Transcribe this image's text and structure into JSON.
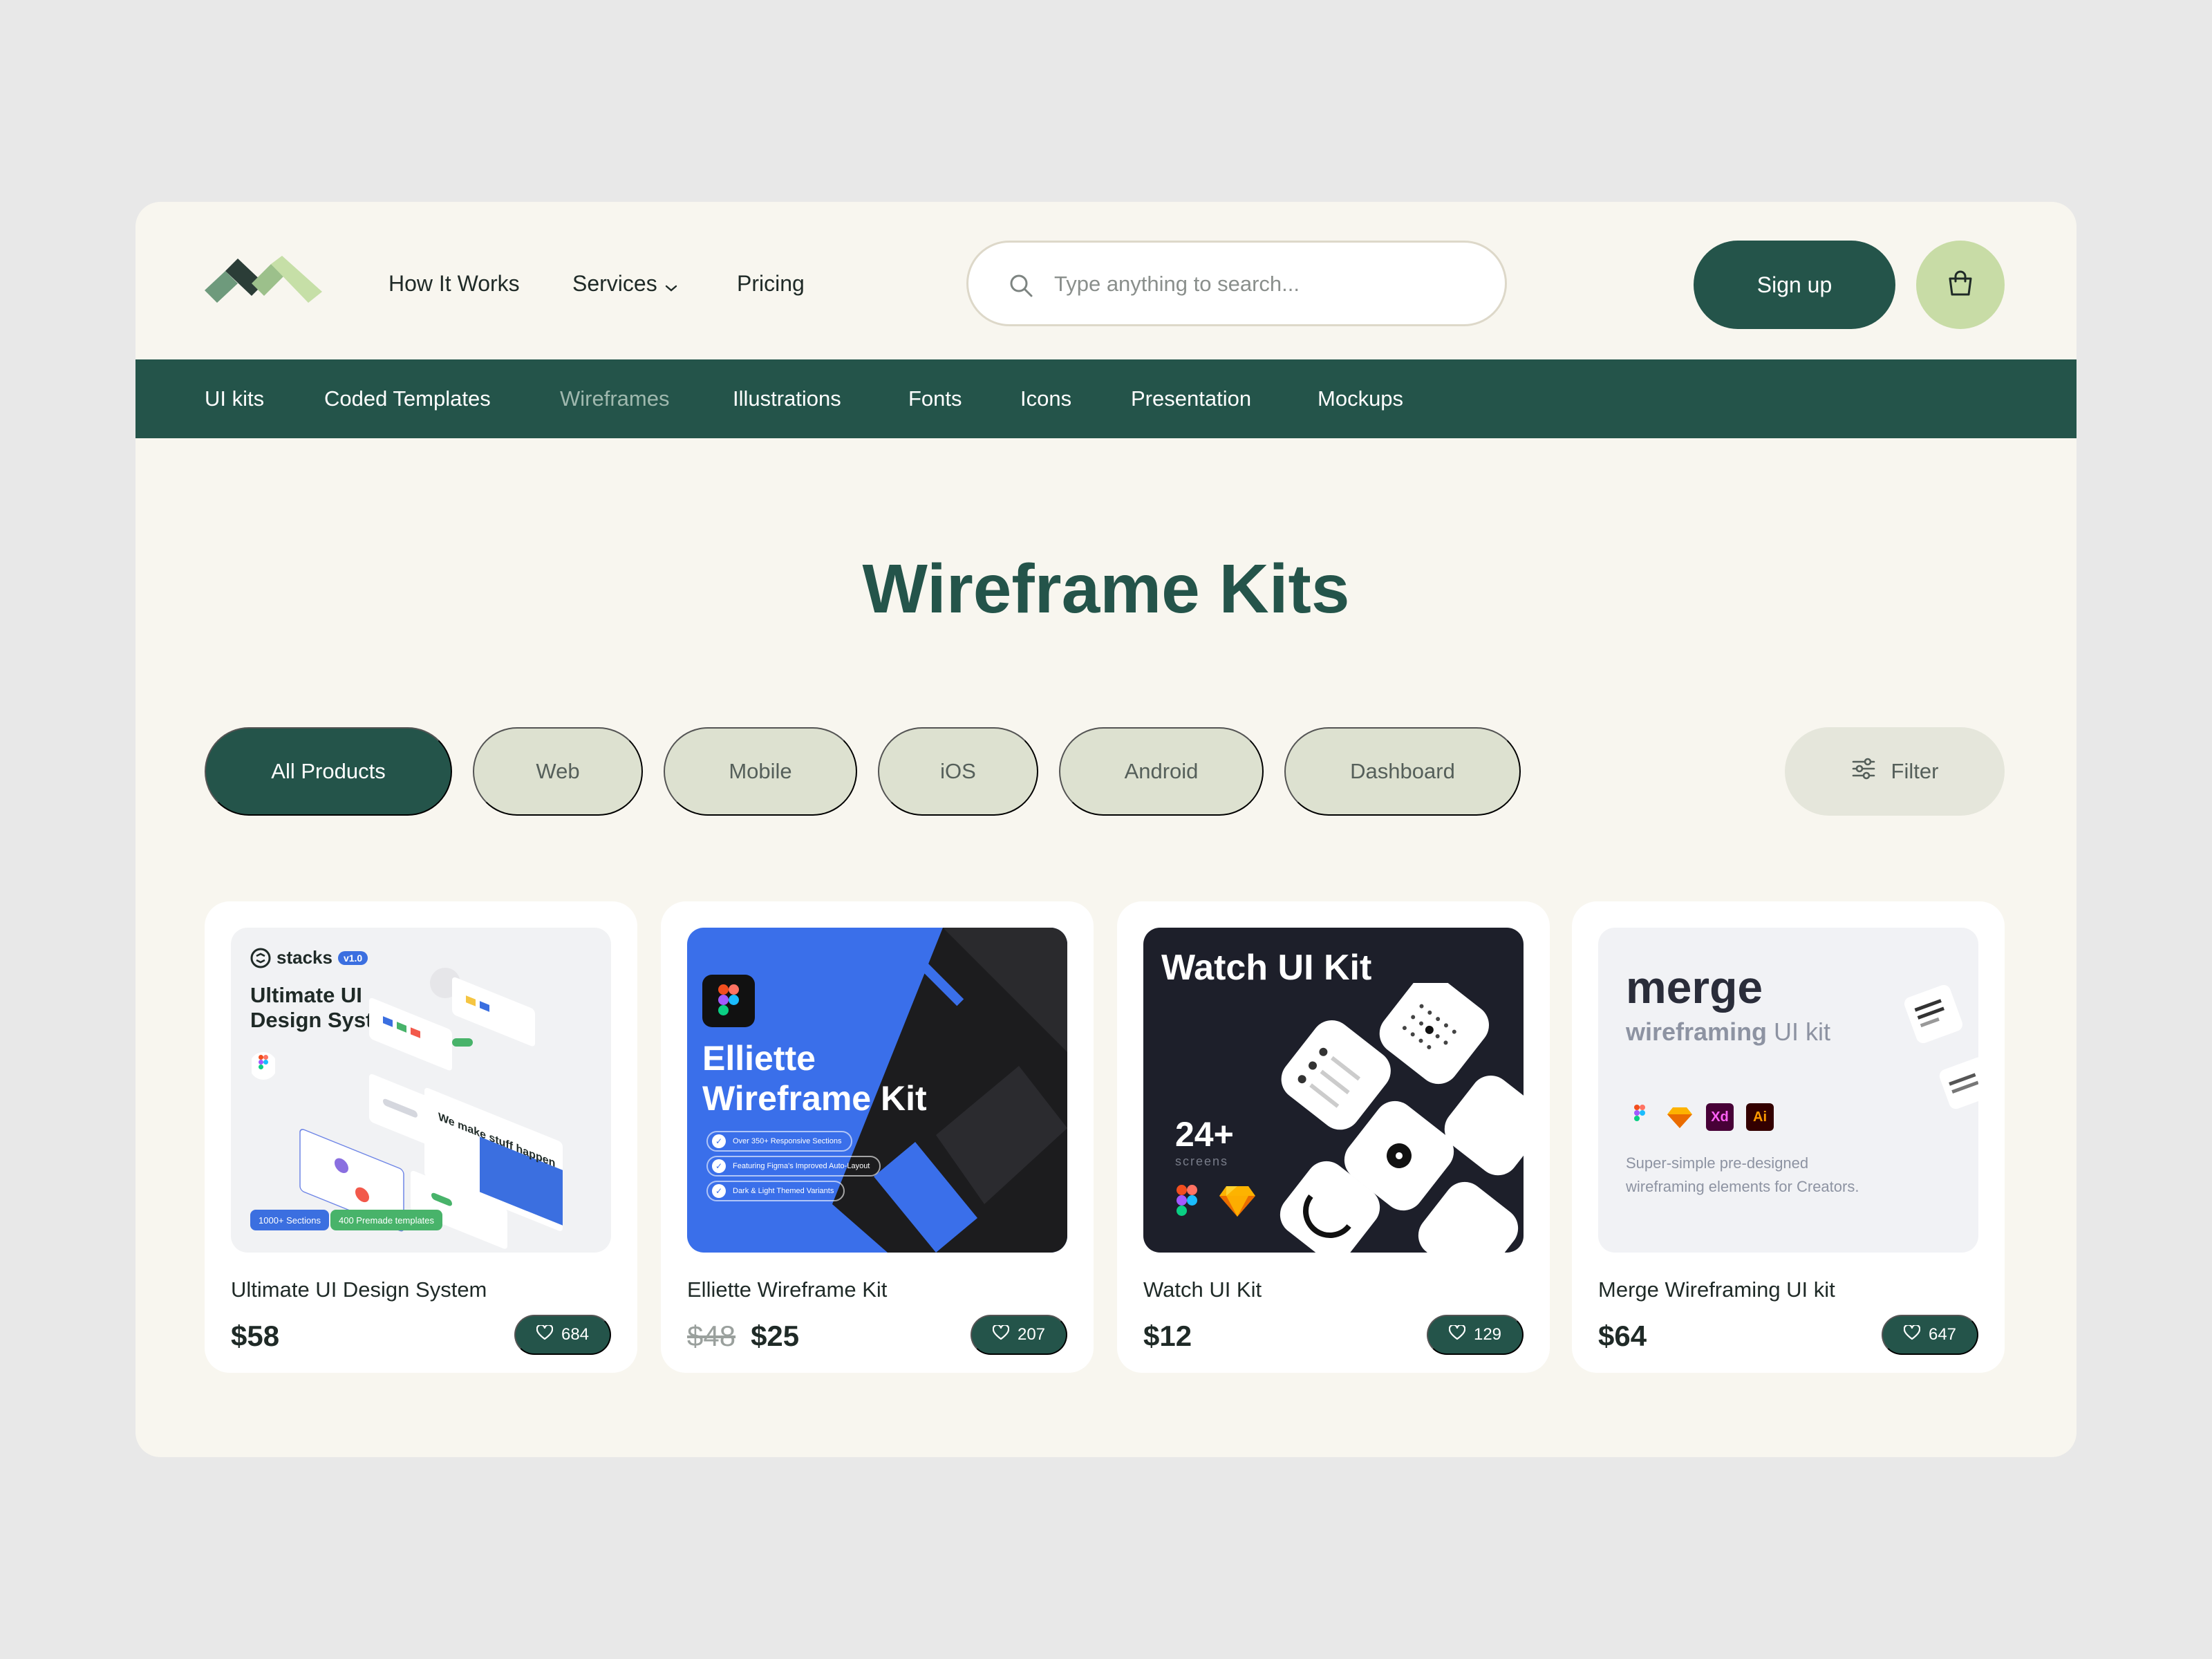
{
  "header": {
    "nav": [
      {
        "label": "How It Works"
      },
      {
        "label": "Services"
      },
      {
        "label": "Pricing"
      }
    ],
    "search_placeholder": "Type anything to search...",
    "signup_label": "Sign up"
  },
  "categories": [
    "UI kits",
    "Coded Templates",
    "Wireframes",
    "Illustrations",
    "Fonts",
    "Icons",
    "Presentation",
    "Mockups"
  ],
  "active_category": "Wireframes",
  "page_title": "Wireframe Kits",
  "filters": [
    "All Products",
    "Web",
    "Mobile",
    "iOS",
    "Android",
    "Dashboard"
  ],
  "active_filter": "All Products",
  "filter_label": "Filter",
  "colors": {
    "primary": "#24544a",
    "accent": "#c8dca6",
    "background": "#f8f6ef"
  },
  "products": [
    {
      "name": "Ultimate UI Design System",
      "price": "$58",
      "likes": "684",
      "thumb": {
        "brand": "stacks",
        "version": "v1.0",
        "title": "Ultimate UI Design System",
        "badge1": "1000+ Sections",
        "badge2": "400 Premade templates",
        "tagline": "We make stuff happen"
      }
    },
    {
      "name": "Elliette Wireframe Kit",
      "old_price": "$48",
      "price": "$25",
      "likes": "207",
      "thumb": {
        "title_line1": "Elliette",
        "title_line2": "Wireframe Kit",
        "features": [
          "Over 350+ Responsive Sections",
          "Featuring Figma's Improved Auto-Layout",
          "Dark & Light Themed Variants"
        ]
      }
    },
    {
      "name": "Watch UI Kit",
      "price": "$12",
      "likes": "129",
      "thumb": {
        "title": "Watch UI Kit",
        "count": "24+",
        "count_label": "screens"
      }
    },
    {
      "name": "Merge Wireframing UI kit",
      "price": "$64",
      "likes": "647",
      "thumb": {
        "title": "merge",
        "subtitle_bold": "wireframing",
        "subtitle_rest": " UI kit",
        "description": "Super-simple pre-designed wireframing elements for Creators.",
        "tool_xd": "Xd",
        "tool_ai": "Ai"
      }
    }
  ]
}
